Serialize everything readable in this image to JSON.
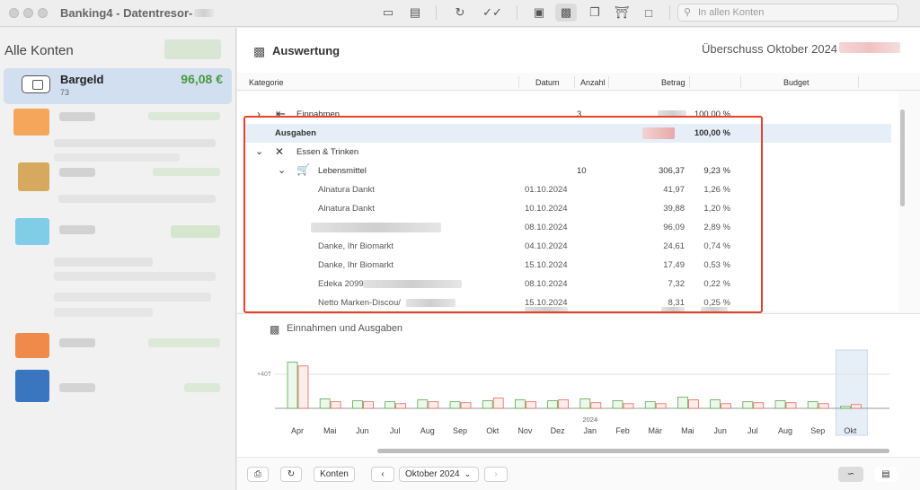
{
  "window": {
    "title": "Banking4 - Datentresor-"
  },
  "search": {
    "placeholder": "In allen Konten"
  },
  "sidebar": {
    "title": "Alle Konten",
    "selected_account": {
      "name": "Bargeld",
      "number": "73",
      "balance": "96,08 €"
    }
  },
  "main": {
    "title": "Auswertung",
    "surplus_label": "Überschuss Oktober 2024"
  },
  "table": {
    "columns": {
      "category": "Kategorie",
      "date": "Datum",
      "count": "Anzahl",
      "amount": "Betrag",
      "budget": "Budget"
    },
    "rows": [
      {
        "kind": "category",
        "label": "Einnahmen",
        "count": "3",
        "amount": "",
        "percent": "100,00 %"
      },
      {
        "kind": "section",
        "label": "Ausgaben",
        "percent": "100,00 %"
      },
      {
        "kind": "group",
        "label": "Essen & Trinken"
      },
      {
        "kind": "subgroup",
        "label": "Lebensmittel",
        "count": "10",
        "amount": "306,37",
        "percent": "9,23 %"
      }
    ],
    "transactions": [
      {
        "name": "Alnatura Dankt",
        "date": "01.10.2024",
        "amount": "41,97",
        "percent": "1,26 %"
      },
      {
        "name": "Alnatura Dankt",
        "date": "10.10.2024",
        "amount": "39,88",
        "percent": "1,20 %"
      },
      {
        "name": "",
        "date": "08.10.2024",
        "amount": "96,09",
        "percent": "2,89 %"
      },
      {
        "name": "Danke, Ihr Biomarkt",
        "date": "04.10.2024",
        "amount": "24,61",
        "percent": "0,74 %"
      },
      {
        "name": "Danke, Ihr Biomarkt",
        "date": "15.10.2024",
        "amount": "17,49",
        "percent": "0,53 %"
      },
      {
        "name": "Edeka 2099",
        "date": "08.10.2024",
        "amount": "7,32",
        "percent": "0,22 %"
      },
      {
        "name": "Netto Marken-Discou/",
        "date": "15.10.2024",
        "amount": "8,31",
        "percent": "0,25 %"
      }
    ]
  },
  "chart": {
    "title": "Einnahmen und Ausgaben",
    "y_tick": "+40T",
    "year_label": "2024",
    "income_color": "#5aa84c",
    "expense_color": "#e06a5e"
  },
  "chart_data": {
    "type": "bar",
    "categories": [
      "Apr",
      "Mai",
      "Jun",
      "Jul",
      "Aug",
      "Sep",
      "Okt",
      "Nov",
      "Dez",
      "Jan",
      "Feb",
      "Mär",
      "Mai",
      "Jun",
      "Jul",
      "Aug",
      "Sep",
      "Okt"
    ],
    "series": [
      {
        "values": [
          49,
          10,
          8,
          7,
          9,
          7,
          8,
          9,
          8,
          10,
          8,
          7,
          12,
          9,
          7,
          8,
          7,
          2
        ]
      },
      {
        "values": [
          45,
          7,
          7,
          5,
          7,
          6,
          11,
          7,
          9,
          6,
          5,
          5,
          9,
          5,
          6,
          6,
          5,
          4
        ]
      }
    ],
    "ylabel": "",
    "yticks": [
      "+40T"
    ],
    "highlighted": "Okt"
  },
  "bottom": {
    "accounts_label": "Konten",
    "period": "Oktober 2024"
  }
}
